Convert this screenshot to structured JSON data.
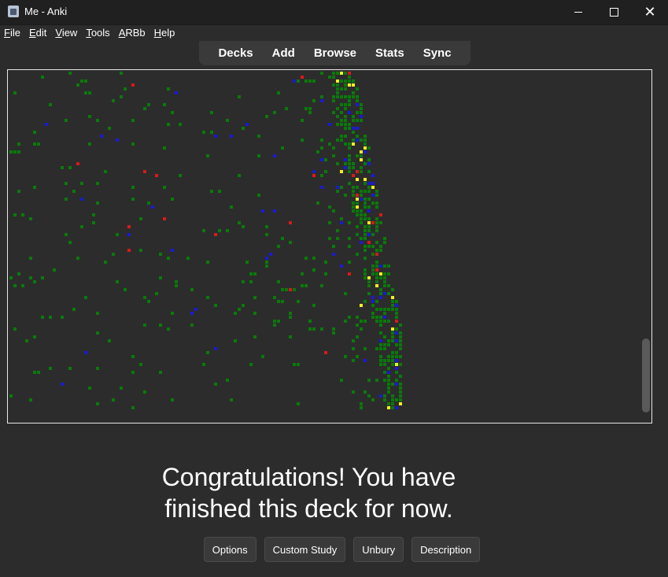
{
  "window": {
    "title": "Me - Anki",
    "minimize_glyph": "",
    "maximize_glyph": "",
    "close_glyph": "✕"
  },
  "menu": [
    {
      "label": "File",
      "mnemonic": "F",
      "rest": "ile"
    },
    {
      "label": "Edit",
      "mnemonic": "E",
      "rest": "dit"
    },
    {
      "label": "View",
      "mnemonic": "V",
      "rest": "iew"
    },
    {
      "label": "Tools",
      "mnemonic": "T",
      "rest": "ools"
    },
    {
      "label": "ARBb",
      "mnemonic": "A",
      "rest": "RBb"
    },
    {
      "label": "Help",
      "mnemonic": "H",
      "rest": "elp"
    }
  ],
  "nav": [
    "Decks",
    "Add",
    "Browse",
    "Stats",
    "Sync"
  ],
  "heatmap": {
    "colors": {
      "green": "#0a7a0a",
      "blue": "#1a1ad8",
      "red": "#d81a1a",
      "yellow": "#f0f020"
    }
  },
  "congrats": {
    "line1": "Congratulations! You have",
    "line2": "finished this deck for now."
  },
  "buttons": [
    "Options",
    "Custom Study",
    "Unbury",
    "Description"
  ]
}
